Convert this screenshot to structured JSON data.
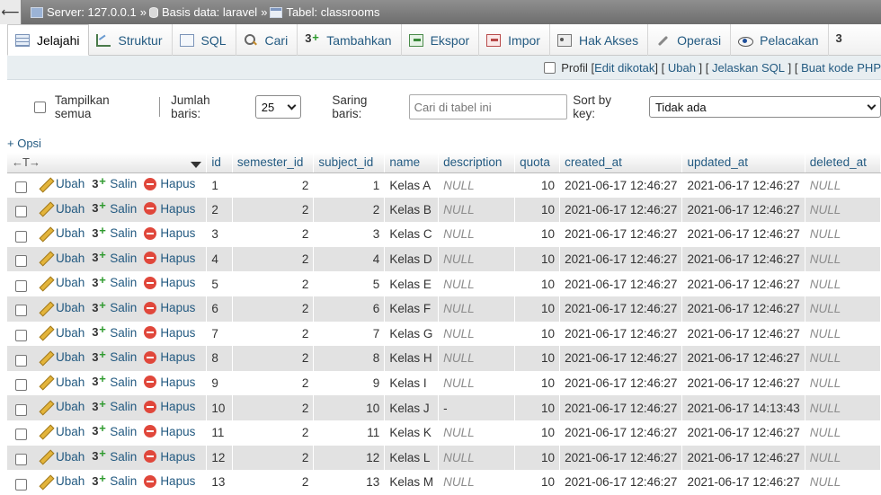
{
  "breadcrumb": {
    "server": "Server: 127.0.0.1",
    "database": "Basis data: laravel",
    "table": "Tabel: classrooms",
    "separator": "»"
  },
  "tabs": [
    {
      "label": "Jelajahi",
      "icon": "browse-icon",
      "active": true
    },
    {
      "label": "Struktur",
      "icon": "structure-icon"
    },
    {
      "label": "SQL",
      "icon": "sql-icon"
    },
    {
      "label": "Cari",
      "icon": "search-icon"
    },
    {
      "label": "Tambahkan",
      "icon": "insert-icon"
    },
    {
      "label": "Ekspor",
      "icon": "export-icon"
    },
    {
      "label": "Impor",
      "icon": "import-icon"
    },
    {
      "label": "Hak Akses",
      "icon": "privileges-icon"
    },
    {
      "label": "Operasi",
      "icon": "operations-icon"
    },
    {
      "label": "Pelacakan",
      "icon": "tracking-icon"
    }
  ],
  "profile_bar": {
    "profile_label": "Profil",
    "edit_inline": "Edit dikotak",
    "edit": "Ubah",
    "explain_sql": "Jelaskan SQL",
    "create_php": "Buat kode PHP",
    "open_bracket": "[",
    "close_bracket": "]"
  },
  "controls": {
    "show_all": "Tampilkan semua",
    "rows_label": "Jumlah baris:",
    "rows_value": "25",
    "filter_label": "Saring baris:",
    "filter_placeholder": "Cari di tabel ini",
    "sort_label": "Sort by key:",
    "sort_value": "Tidak ada"
  },
  "options_link": "+ Opsi",
  "table": {
    "arrows": "←T→",
    "columns": [
      "id",
      "semester_id",
      "subject_id",
      "name",
      "description",
      "quota",
      "created_at",
      "updated_at",
      "deleted_at"
    ],
    "action_labels": {
      "edit": "Ubah",
      "copy": "Salin",
      "delete": "Hapus"
    },
    "rows": [
      {
        "id": "1",
        "semester_id": "2",
        "subject_id": "1",
        "name": "Kelas A",
        "description": "NULL",
        "quota": "10",
        "created_at": "2021-06-17 12:46:27",
        "updated_at": "2021-06-17 12:46:27",
        "deleted_at": "NULL"
      },
      {
        "id": "2",
        "semester_id": "2",
        "subject_id": "2",
        "name": "Kelas B",
        "description": "NULL",
        "quota": "10",
        "created_at": "2021-06-17 12:46:27",
        "updated_at": "2021-06-17 12:46:27",
        "deleted_at": "NULL"
      },
      {
        "id": "3",
        "semester_id": "2",
        "subject_id": "3",
        "name": "Kelas C",
        "description": "NULL",
        "quota": "10",
        "created_at": "2021-06-17 12:46:27",
        "updated_at": "2021-06-17 12:46:27",
        "deleted_at": "NULL"
      },
      {
        "id": "4",
        "semester_id": "2",
        "subject_id": "4",
        "name": "Kelas D",
        "description": "NULL",
        "quota": "10",
        "created_at": "2021-06-17 12:46:27",
        "updated_at": "2021-06-17 12:46:27",
        "deleted_at": "NULL"
      },
      {
        "id": "5",
        "semester_id": "2",
        "subject_id": "5",
        "name": "Kelas E",
        "description": "NULL",
        "quota": "10",
        "created_at": "2021-06-17 12:46:27",
        "updated_at": "2021-06-17 12:46:27",
        "deleted_at": "NULL"
      },
      {
        "id": "6",
        "semester_id": "2",
        "subject_id": "6",
        "name": "Kelas F",
        "description": "NULL",
        "quota": "10",
        "created_at": "2021-06-17 12:46:27",
        "updated_at": "2021-06-17 12:46:27",
        "deleted_at": "NULL"
      },
      {
        "id": "7",
        "semester_id": "2",
        "subject_id": "7",
        "name": "Kelas G",
        "description": "NULL",
        "quota": "10",
        "created_at": "2021-06-17 12:46:27",
        "updated_at": "2021-06-17 12:46:27",
        "deleted_at": "NULL"
      },
      {
        "id": "8",
        "semester_id": "2",
        "subject_id": "8",
        "name": "Kelas H",
        "description": "NULL",
        "quota": "10",
        "created_at": "2021-06-17 12:46:27",
        "updated_at": "2021-06-17 12:46:27",
        "deleted_at": "NULL"
      },
      {
        "id": "9",
        "semester_id": "2",
        "subject_id": "9",
        "name": "Kelas I",
        "description": "NULL",
        "quota": "10",
        "created_at": "2021-06-17 12:46:27",
        "updated_at": "2021-06-17 12:46:27",
        "deleted_at": "NULL"
      },
      {
        "id": "10",
        "semester_id": "2",
        "subject_id": "10",
        "name": "Kelas J",
        "description": "-",
        "quota": "10",
        "created_at": "2021-06-17 12:46:27",
        "updated_at": "2021-06-17 14:13:43",
        "deleted_at": "NULL"
      },
      {
        "id": "11",
        "semester_id": "2",
        "subject_id": "11",
        "name": "Kelas K",
        "description": "NULL",
        "quota": "10",
        "created_at": "2021-06-17 12:46:27",
        "updated_at": "2021-06-17 12:46:27",
        "deleted_at": "NULL"
      },
      {
        "id": "12",
        "semester_id": "2",
        "subject_id": "12",
        "name": "Kelas L",
        "description": "NULL",
        "quota": "10",
        "created_at": "2021-06-17 12:46:27",
        "updated_at": "2021-06-17 12:46:27",
        "deleted_at": "NULL"
      },
      {
        "id": "13",
        "semester_id": "2",
        "subject_id": "13",
        "name": "Kelas M",
        "description": "NULL",
        "quota": "10",
        "created_at": "2021-06-17 12:46:27",
        "updated_at": "2021-06-17 12:46:27",
        "deleted_at": "NULL"
      }
    ]
  },
  "colors": {
    "link": "#235a81",
    "null_text": "#8c8c8c",
    "row_alt": "#e2e2e2",
    "delete": "#e0473b"
  }
}
